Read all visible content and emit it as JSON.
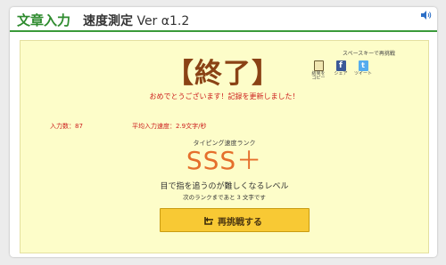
{
  "header": {
    "title_main": "文章入力",
    "title_sub": "速度測定",
    "title_version": "Ver α1.2"
  },
  "result": {
    "heading": "【終了】",
    "retry_key_hint": "スペースキーで再挑戦",
    "congrats": "おめでとうございます！記録を更新しました！",
    "input_count": "入力数：87",
    "avg_speed": "平均入力速度：2.9文字/秒"
  },
  "share": {
    "copy_label": "結果を\nコピー",
    "facebook_label": "シェア",
    "twitter_label": "ツイート",
    "facebook_glyph": "f",
    "twitter_glyph": "t"
  },
  "rank": {
    "label": "タイピング速度ランク",
    "value": "SSS＋",
    "description": "目で指を追うのが難しくなるレベル",
    "next": "次のランクまであと 3 文字です"
  },
  "retry_button": {
    "label": "再挑戦する"
  },
  "colors": {
    "brand_green": "#2e8b2e",
    "panel_bg": "#fdfdc9",
    "heading_brown": "#8a4215",
    "alert_red": "#cc1b1b",
    "rank_orange": "#e56f2c",
    "button_yellow": "#f8c934"
  },
  "icons": {
    "sound": "speaker-icon",
    "copy": "copy-icon",
    "facebook": "facebook-icon",
    "twitter": "twitter-icon",
    "retry": "retry-icon"
  }
}
